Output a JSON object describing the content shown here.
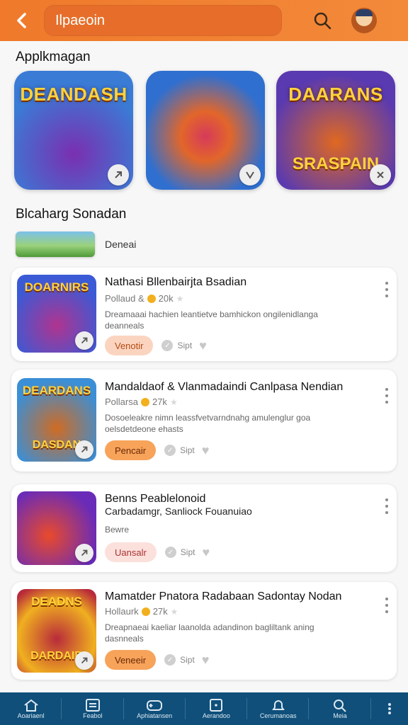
{
  "top_bar": {
    "back_icon": "back-chevron-icon",
    "search_text": "Ilpaeoin",
    "search_icon": "search-icon",
    "profile_icon": "avatar-icon"
  },
  "sections": {
    "featured_title": "Applkmagan",
    "list_title": "Blcaharg Sonadan",
    "mini_label": "Deneai"
  },
  "featured": [
    {
      "label": "DEANDASH",
      "label2": "",
      "bg": "#3a7bd6",
      "accent": "#7a2fb0"
    },
    {
      "label": "",
      "label2": "",
      "bg": "#2f6fd0",
      "accent": "#d63a5a"
    },
    {
      "label": "DAARANS",
      "label2": "SRASPAIN",
      "bg": "#5a3ab0",
      "accent": "#e06820"
    }
  ],
  "cards": [
    {
      "thumb_title": "DOARNIRS",
      "thumb_sub": "",
      "title": "Nathasi Bllenbairjta Bsadian",
      "publisher": "Pollaud &",
      "rating": "20k",
      "desc": "Dreamaaai hachien leantietve bamhickon ongilenidlanga deanneals",
      "button": "Venotir",
      "button_style": "light",
      "save_label": "Sipt",
      "thumb_bg": "#3a5ad6",
      "thumb_accent": "#b0348f"
    },
    {
      "thumb_title": "DEARDANS",
      "thumb_sub": "DASDAN",
      "title": "Mandaldaof & Vlanmadaindi Canlpasa Nendian",
      "publisher": "Pollarsa",
      "rating": "27k",
      "desc": "Dosoeleakre nimn leassfvetvarndnahg amulenglur goa oelsdetdeone ehasts",
      "button": "Pencair",
      "button_style": "solid",
      "save_label": "Sipt",
      "thumb_bg": "#3b8fd6",
      "thumb_accent": "#d06b22"
    },
    {
      "thumb_title": "",
      "thumb_sub": "",
      "title": "Benns Peablelonoid",
      "subtitle": "Carbadamgr, Sanliock Fouanuiao",
      "publisher": "",
      "rating": "",
      "desc": "Bewre",
      "button": "Uansalr",
      "button_style": "pink",
      "save_label": "Sipt",
      "thumb_bg": "#6a2bb8",
      "thumb_accent": "#e94a2b"
    },
    {
      "thumb_title": "DEADNS",
      "thumb_sub": "DARDAIR",
      "title": "Mamatder Pnatora Radabaan Sadontay Nodan",
      "publisher": "Hollaurk",
      "rating": "27k",
      "desc": "Dreapnaeai kaeliar laanolda adandinon bagliltank aning dasnneals",
      "button": "Veneeir",
      "button_style": "solid",
      "save_label": "Sipt",
      "thumb_bg": "#b82a3a",
      "thumb_accent": "#f0b020"
    }
  ],
  "bottom_nav": [
    {
      "label": "Aoariaenl",
      "icon": "home-icon"
    },
    {
      "label": "Feabol",
      "icon": "list-icon"
    },
    {
      "label": "Aphiatansen",
      "icon": "gamepad-icon"
    },
    {
      "label": "Aerandoo",
      "icon": "box-icon"
    },
    {
      "label": "Cerumanoas",
      "icon": "bell-icon"
    },
    {
      "label": "Meia",
      "icon": "search-icon"
    },
    {
      "label": "",
      "icon": "more-vertical-icon"
    }
  ],
  "colors": {
    "top_bar": "#f0792b",
    "bottom_nav": "#0f4f7a",
    "accent": "#f7a35a"
  }
}
